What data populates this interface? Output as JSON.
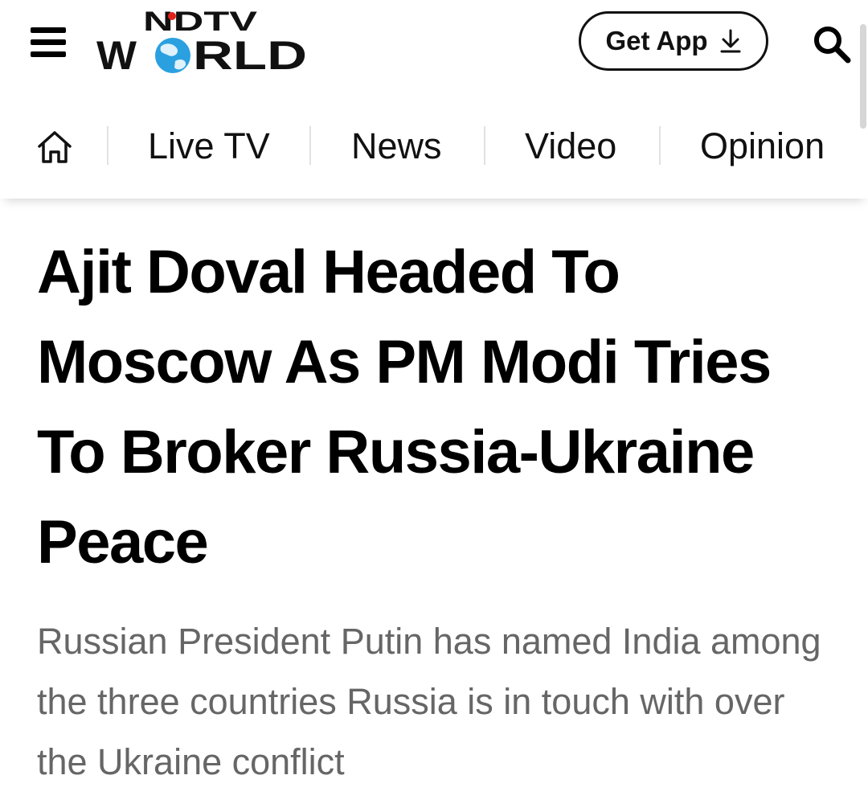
{
  "header": {
    "logo": {
      "line1": "NDTV",
      "line2_left": "W",
      "line2_right": "RLD"
    },
    "get_app_label": "Get App",
    "icons": {
      "menu": "hamburger-menu-icon",
      "download": "download-arrow-icon",
      "search": "search-icon",
      "home": "home-icon"
    }
  },
  "nav": {
    "items": [
      {
        "label": "Live TV"
      },
      {
        "label": "News"
      },
      {
        "label": "Video"
      },
      {
        "label": "Opinion"
      }
    ]
  },
  "article": {
    "headline": "Ajit Doval Headed To Moscow As PM Modi Tries To Broker Russia-Ukraine Peace",
    "summary": "Russian President Putin has named India among the three countries Russia is in touch with over the Ukraine conflict"
  },
  "colors": {
    "text": "#000000",
    "summary_text": "#666666",
    "logo_dot": "#e2231a",
    "globe": "#2aa0e0",
    "divider": "#e2e2e2"
  }
}
